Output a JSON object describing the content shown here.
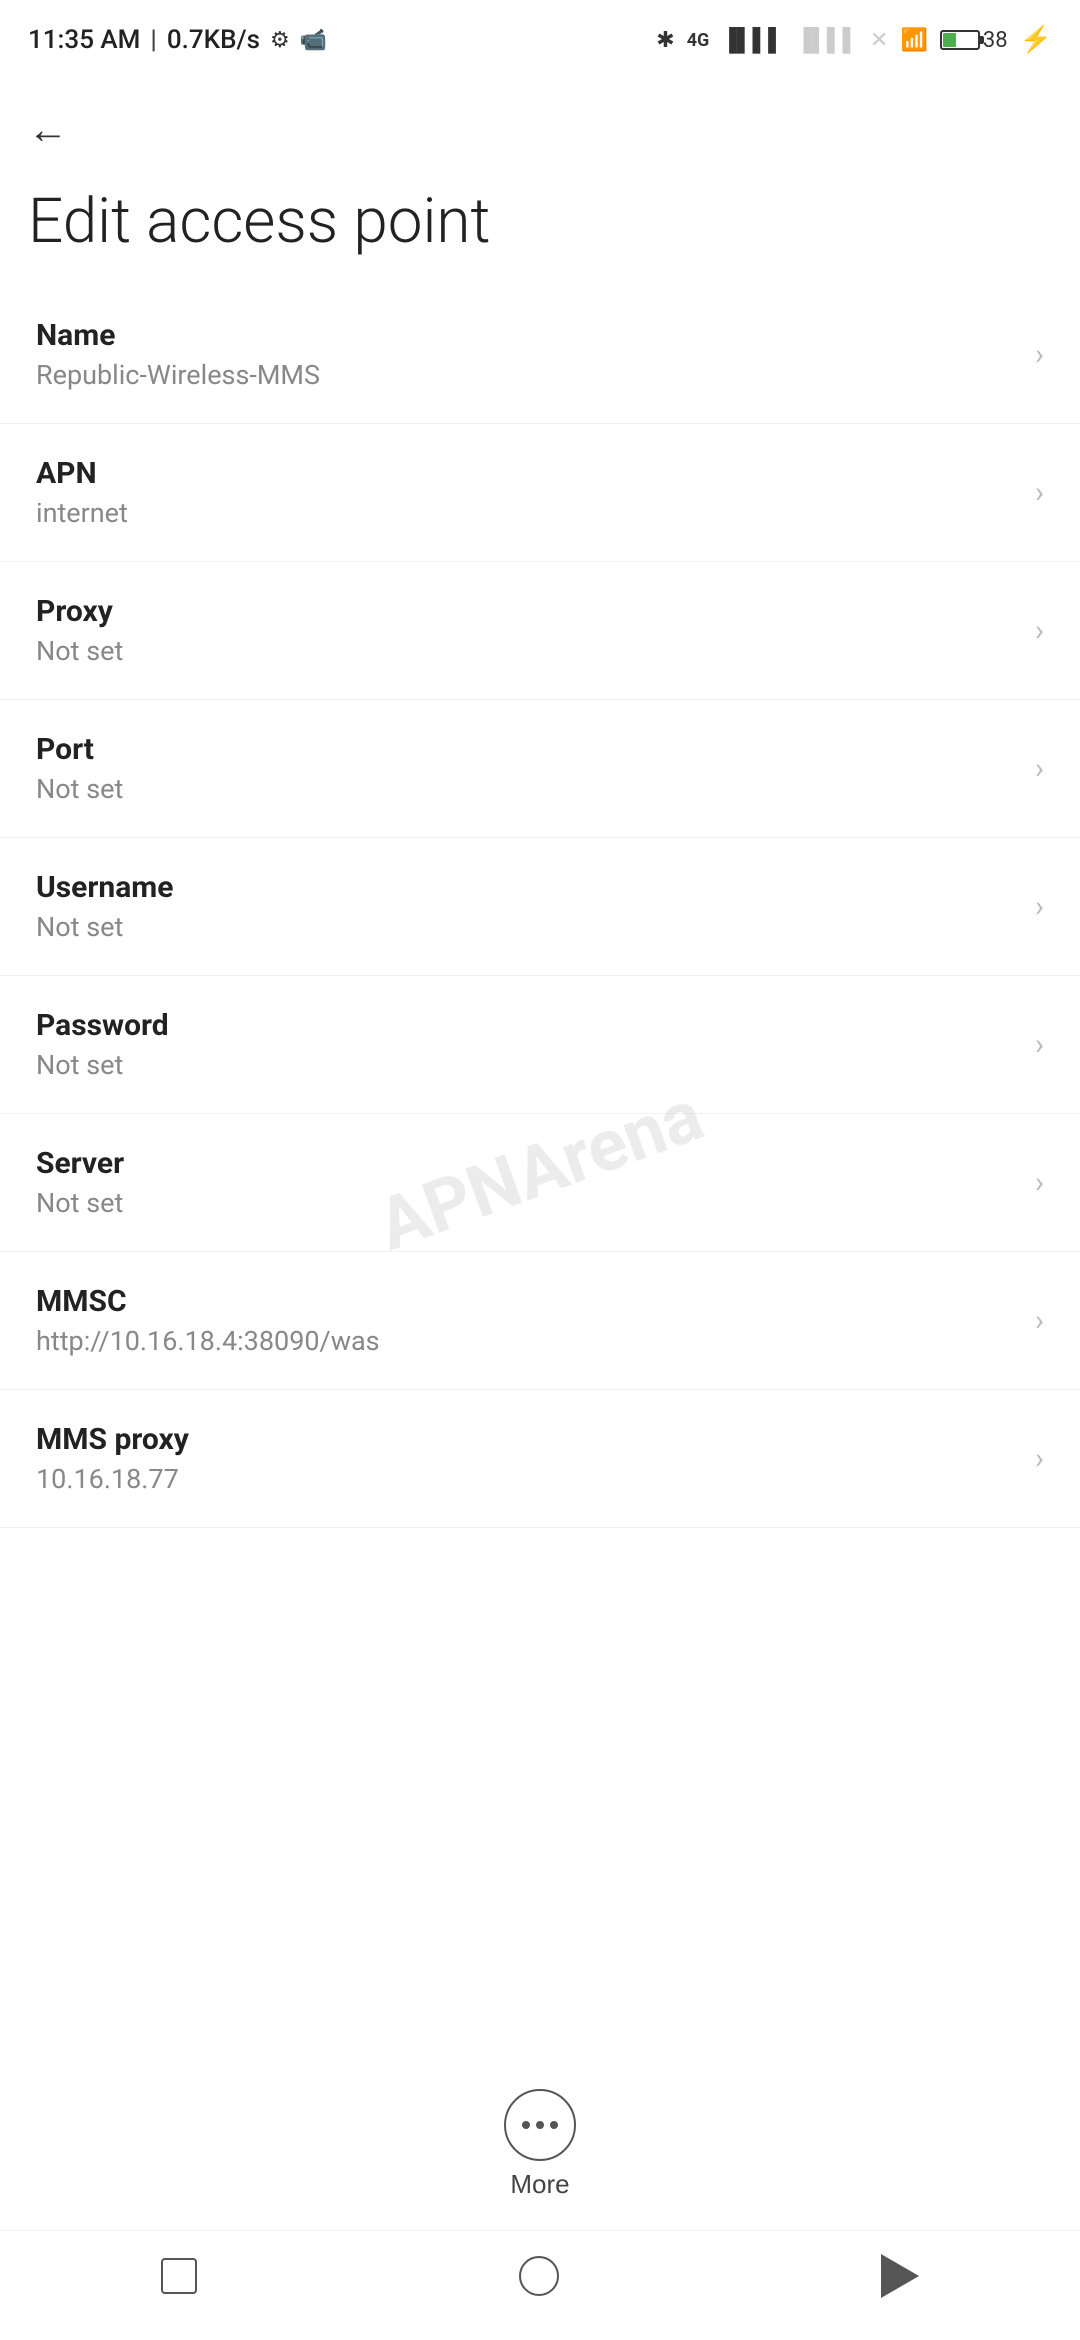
{
  "status_bar": {
    "time": "11:35 AM",
    "speed": "0.7KB/s"
  },
  "page": {
    "title": "Edit access point",
    "back_label": "←"
  },
  "settings_items": [
    {
      "label": "Name",
      "value": "Republic-Wireless-MMS"
    },
    {
      "label": "APN",
      "value": "internet"
    },
    {
      "label": "Proxy",
      "value": "Not set"
    },
    {
      "label": "Port",
      "value": "Not set"
    },
    {
      "label": "Username",
      "value": "Not set"
    },
    {
      "label": "Password",
      "value": "Not set"
    },
    {
      "label": "Server",
      "value": "Not set"
    },
    {
      "label": "MMSC",
      "value": "http://10.16.18.4:38090/was"
    },
    {
      "label": "MMS proxy",
      "value": "10.16.18.77"
    }
  ],
  "more_button": {
    "label": "More"
  },
  "watermark": "APNArena"
}
